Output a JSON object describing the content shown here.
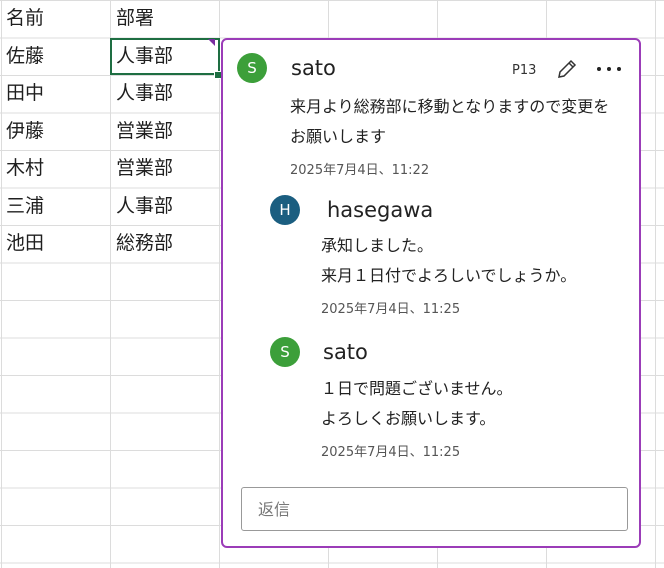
{
  "sheet": {
    "header": {
      "col_a": "名前",
      "col_b": "部署"
    },
    "rows": [
      {
        "name": "佐藤",
        "dept": "人事部"
      },
      {
        "name": "田中",
        "dept": "人事部"
      },
      {
        "name": "伊藤",
        "dept": "営業部"
      },
      {
        "name": "木村",
        "dept": "営業部"
      },
      {
        "name": "三浦",
        "dept": "人事部"
      },
      {
        "name": "池田",
        "dept": "総務部"
      }
    ]
  },
  "comment": {
    "sheet_ref": "P13",
    "thread": [
      {
        "initial": "S",
        "author": "sato",
        "avatar_color": "#3c9f3a",
        "lines": [
          "来月より総務部に移動となりますので変更を",
          "お願いします"
        ],
        "timestamp": "2025年7月4日、11:22"
      },
      {
        "initial": "H",
        "author": "hasegawa",
        "avatar_color": "#1b5e80",
        "lines": [
          "承知しました。",
          "来月１日付でよろしいでしょうか。"
        ],
        "timestamp": "2025年7月4日、11:25"
      },
      {
        "initial": "S",
        "author": "sato",
        "avatar_color": "#3c9f3a",
        "lines": [
          "１日で問題ございません。",
          "よろしくお願いします。"
        ],
        "timestamp": "2025年7月4日、11:25"
      }
    ],
    "reply_placeholder": "返信",
    "edit_icon": "pencil-icon",
    "more_icon": "more-options-icon",
    "accent_color": "#9b3cb8"
  }
}
